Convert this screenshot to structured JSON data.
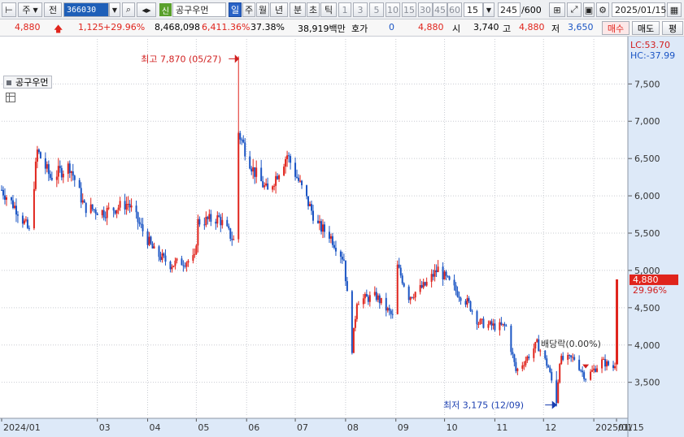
{
  "toolbar": {
    "period_type": "주",
    "prev_label": "전",
    "stock_code": "366030",
    "stock_badge": "신",
    "stock_name": "공구우먼",
    "periods": [
      "일",
      "주",
      "월",
      "년",
      "분",
      "초",
      "틱"
    ],
    "active_period": "일",
    "minute_options": [
      "1",
      "3",
      "5",
      "10",
      "15",
      "30",
      "45",
      "60"
    ],
    "minute_selected": "15",
    "count_value": "245",
    "count_total": "/600",
    "date": "2025/01/15"
  },
  "infobar": {
    "price": "4,880",
    "change": "1,125",
    "change_pct": "+29.96%",
    "volume": "8,468,098",
    "volume_pct": "6,411.36%",
    "turnover_pct": "37.38%",
    "amount": "38,919백만",
    "hoga_label": "호가",
    "hoga_value": "0",
    "hoga_price": "4,880",
    "open_label": "시",
    "open_value": "3,740",
    "high_label": "고",
    "high_value": "4,880",
    "low_label": "저",
    "low_value": "3,650",
    "buy_label": "매수",
    "sell_label": "매도",
    "eval_label": "평"
  },
  "legend": {
    "series_name": "공구우먼"
  },
  "colors": {
    "up": "#e0241c",
    "down": "#1b55c4",
    "axis_panel": "#dde9f8",
    "current_price_box": "#e0241c"
  },
  "chart_data": {
    "type": "candlestick",
    "y_axis": {
      "range": [
        3050,
        7950
      ],
      "ticks": [
        3500,
        4000,
        4500,
        5000,
        5500,
        6000,
        6500,
        7000,
        7500
      ],
      "tick_labels": [
        "3,500",
        "4,000",
        "4,500",
        "5,000",
        "5,500",
        "6,000",
        "6,500",
        "7,000",
        "7,500"
      ]
    },
    "x_axis": {
      "range": [
        "2024-01-02",
        "2025-01-21"
      ],
      "ticks": [
        {
          "date": "2024-01-02",
          "label": "2024/01"
        },
        {
          "date": "2024-03-01",
          "label": "03"
        },
        {
          "date": "2024-04-01",
          "label": "04"
        },
        {
          "date": "2024-05-01",
          "label": "05"
        },
        {
          "date": "2024-06-01",
          "label": "06"
        },
        {
          "date": "2024-07-01",
          "label": "07"
        },
        {
          "date": "2024-08-01",
          "label": "08"
        },
        {
          "date": "2024-09-01",
          "label": "09"
        },
        {
          "date": "2024-10-01",
          "label": "10"
        },
        {
          "date": "2024-11-01",
          "label": "11"
        },
        {
          "date": "2024-12-01",
          "label": "12"
        },
        {
          "date": "2025-01-01",
          "label": "2025/01"
        },
        {
          "date": "2025-01-15",
          "label": "01/15"
        }
      ]
    },
    "grid": true,
    "keypoints": [
      {
        "date": "2024-01-02",
        "close": 6080
      },
      {
        "date": "2024-01-12",
        "close": 5800
      },
      {
        "date": "2024-01-19",
        "close": 5520
      },
      {
        "date": "2024-01-24",
        "close": 6600
      },
      {
        "date": "2024-02-01",
        "close": 6250
      },
      {
        "date": "2024-02-13",
        "close": 6400
      },
      {
        "date": "2024-02-22",
        "close": 5850
      },
      {
        "date": "2024-03-05",
        "close": 5780
      },
      {
        "date": "2024-03-20",
        "close": 5900
      },
      {
        "date": "2024-04-05",
        "close": 5250
      },
      {
        "date": "2024-04-15",
        "close": 5080
      },
      {
        "date": "2024-04-30",
        "close": 5150
      },
      {
        "date": "2024-05-02",
        "close": 5650
      },
      {
        "date": "2024-05-15",
        "close": 5700
      },
      {
        "date": "2024-05-24",
        "close": 5400
      },
      {
        "date": "2024-05-27",
        "close": 6850
      },
      {
        "date": "2024-06-05",
        "close": 6350
      },
      {
        "date": "2024-06-14",
        "close": 6050
      },
      {
        "date": "2024-06-26",
        "close": 6550
      },
      {
        "date": "2024-07-05",
        "close": 6100
      },
      {
        "date": "2024-07-15",
        "close": 5600
      },
      {
        "date": "2024-07-22",
        "close": 5480
      },
      {
        "date": "2024-07-31",
        "close": 5150
      },
      {
        "date": "2024-08-05",
        "close": 3950
      },
      {
        "date": "2024-08-08",
        "close": 4600
      },
      {
        "date": "2024-08-20",
        "close": 4650
      },
      {
        "date": "2024-08-30",
        "close": 4380
      },
      {
        "date": "2024-09-02",
        "close": 5050
      },
      {
        "date": "2024-09-09",
        "close": 4650
      },
      {
        "date": "2024-09-19",
        "close": 4800
      },
      {
        "date": "2024-09-27",
        "close": 5020
      },
      {
        "date": "2024-10-07",
        "close": 4750
      },
      {
        "date": "2024-10-16",
        "close": 4550
      },
      {
        "date": "2024-10-22",
        "close": 4300
      },
      {
        "date": "2024-11-01",
        "close": 4250
      },
      {
        "date": "2024-11-08",
        "close": 4250
      },
      {
        "date": "2024-11-14",
        "close": 3650
      },
      {
        "date": "2024-11-20",
        "close": 3800
      },
      {
        "date": "2024-11-27",
        "close": 4020
      },
      {
        "date": "2024-12-04",
        "close": 3700
      },
      {
        "date": "2024-12-09",
        "close": 3250
      },
      {
        "date": "2024-12-11",
        "close": 3800
      },
      {
        "date": "2024-12-20",
        "close": 3820
      },
      {
        "date": "2024-12-27",
        "close": 3560
      },
      {
        "date": "2025-01-06",
        "close": 3780
      },
      {
        "date": "2025-01-13",
        "close": 3700
      },
      {
        "date": "2025-01-14",
        "close": 3755
      },
      {
        "date": "2025-01-15",
        "open": 3740,
        "high": 4880,
        "low": 3650,
        "close": 4880
      }
    ],
    "annotations": {
      "high": {
        "text": "최고 7,870 (05/27)",
        "date": "2024-05-27",
        "value": 7870
      },
      "low": {
        "text": "최저 3,175 (12/09)",
        "date": "2024-12-09",
        "value": 3175
      },
      "dividend": {
        "text": "배당락(0.00%)",
        "date": "2024-12-27"
      }
    },
    "current_price": {
      "value": 4880,
      "label": "4,880",
      "change_label": "29.96%"
    },
    "lc_label": "LC:53.70",
    "hc_label": "HC:-37.99"
  }
}
